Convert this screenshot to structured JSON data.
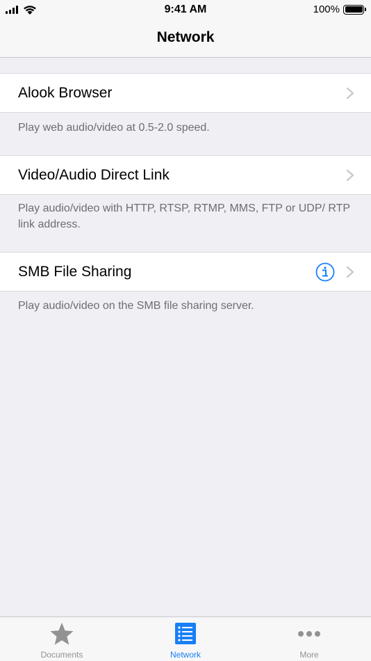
{
  "status_bar": {
    "time": "9:41 AM",
    "battery": "100%"
  },
  "nav": {
    "title": "Network"
  },
  "sections": [
    {
      "label": "Alook Browser",
      "footer": "Play web audio/video at 0.5-2.0 speed."
    },
    {
      "label": "Video/Audio Direct Link",
      "footer": "Play audio/video with HTTP, RTSP, RTMP, MMS, FTP or UDP/ RTP link address."
    },
    {
      "label": "SMB File Sharing",
      "footer": "Play audio/video on the SMB file sharing server."
    }
  ],
  "tabs": [
    {
      "label": "Documents",
      "icon": "star-icon"
    },
    {
      "label": "Network",
      "icon": "list-icon",
      "active": true
    },
    {
      "label": "More",
      "icon": "more-dots-icon"
    }
  ],
  "colors": {
    "accent": "#1a7ff5",
    "background": "#efeff4",
    "chevron": "#c7c7cc",
    "inactive_tab": "#929292"
  }
}
